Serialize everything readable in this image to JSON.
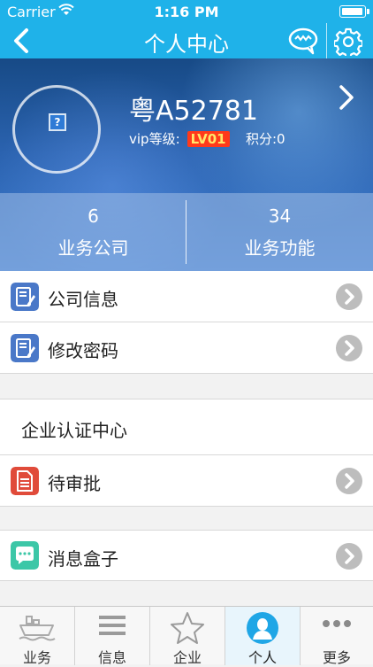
{
  "status_bar": {
    "carrier": "Carrier",
    "time": "1:16 PM",
    "battery_level": 1.0
  },
  "nav": {
    "title": "个人中心"
  },
  "profile": {
    "plate": "粤A52781",
    "vip_label": "vip等级:",
    "vip_level": "LV01",
    "points": "积分:0",
    "avatar_placeholder": "?"
  },
  "stats": [
    {
      "value": "6",
      "label": "业务公司"
    },
    {
      "value": "34",
      "label": "业务功能"
    }
  ],
  "menu": {
    "company_info": "公司信息",
    "change_password": "修改密码",
    "section_title": "企业认证中心",
    "pending_approval": "待审批",
    "message_box": "消息盒子"
  },
  "tabs": [
    {
      "label": "业务",
      "icon": "ship-icon",
      "active": false
    },
    {
      "label": "信息",
      "icon": "list-icon",
      "active": false
    },
    {
      "label": "企业",
      "icon": "star-icon",
      "active": false
    },
    {
      "label": "个人",
      "icon": "person-icon",
      "active": true
    },
    {
      "label": "更多",
      "icon": "more-icon",
      "active": false
    }
  ],
  "colors": {
    "accent": "#1fb2e9",
    "active_tab": "#1fa6e6",
    "doc_icon": "#4a78c8",
    "pending_icon": "#e04b3a",
    "message_icon": "#3cc7a7"
  }
}
